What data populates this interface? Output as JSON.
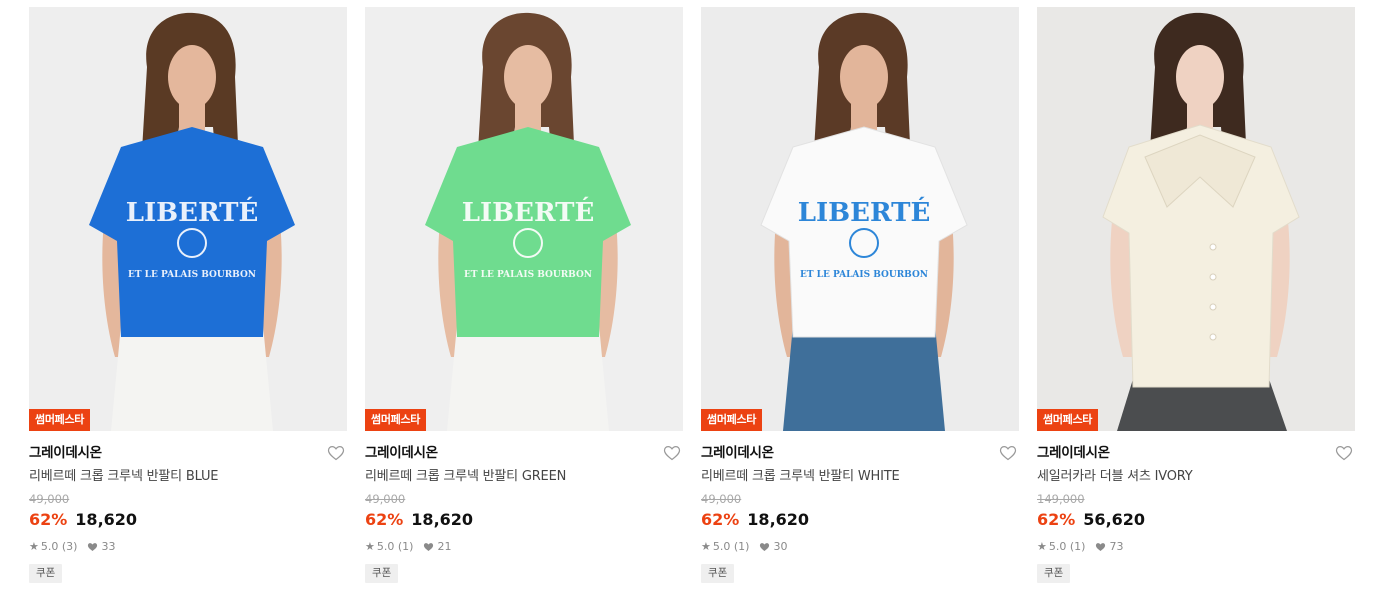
{
  "products": [
    {
      "badge": "썸머페스타",
      "brand": "그레이데시온",
      "name": "리베르떼 크롭 크루넥 반팔티 BLUE",
      "original_price": "49,000",
      "discount_rate": "62%",
      "price": "18,620",
      "rating": "5.0 (3)",
      "likes": "33",
      "coupon": "쿠폰",
      "print_text": "LIBERTÉ",
      "print_sub": "ET LE PALAIS BOURBON",
      "colors": {
        "bg": "#eeeeee",
        "top": "#1d6fd6",
        "print": "#e9f0fb",
        "bottom": "#f4f4f2",
        "hair": "#5a3a24",
        "skin": "#e4b79c"
      }
    },
    {
      "badge": "썸머페스타",
      "brand": "그레이데시온",
      "name": "리베르떼 크롭 크루넥 반팔티 GREEN",
      "original_price": "49,000",
      "discount_rate": "62%",
      "price": "18,620",
      "rating": "5.0 (1)",
      "likes": "21",
      "coupon": "쿠폰",
      "print_text": "LIBERTÉ",
      "print_sub": "ET LE PALAIS BOURBON",
      "colors": {
        "bg": "#efefef",
        "top": "#6fdc8f",
        "print": "#f3fbf5",
        "bottom": "#f4f4f2",
        "hair": "#6a4630",
        "skin": "#e6bca2"
      }
    },
    {
      "badge": "썸머페스타",
      "brand": "그레이데시온",
      "name": "리베르떼 크롭 크루넥 반팔티 WHITE",
      "original_price": "49,000",
      "discount_rate": "62%",
      "price": "18,620",
      "rating": "5.0 (1)",
      "likes": "30",
      "coupon": "쿠폰",
      "print_text": "LIBERTÉ",
      "print_sub": "ET LE PALAIS BOURBON",
      "colors": {
        "bg": "#ececec",
        "top": "#fafafa",
        "print": "#2d86d8",
        "bottom": "#3f6f9a",
        "hair": "#5b3a26",
        "skin": "#e2b59a"
      }
    },
    {
      "badge": "썸머페스타",
      "brand": "그레이데시온",
      "name": "세일러카라 더블 셔츠 IVORY",
      "original_price": "149,000",
      "discount_rate": "62%",
      "price": "56,620",
      "rating": "5.0 (1)",
      "likes": "73",
      "coupon": "쿠폰",
      "print_text": "",
      "print_sub": "",
      "colors": {
        "bg": "#e9e8e6",
        "top": "#f4efe0",
        "print": "#f4efe0",
        "bottom": "#4b4d4f",
        "hair": "#3e2a1f",
        "skin": "#efd2c2"
      }
    }
  ],
  "icons": {
    "wishlist": "heart-outline-icon",
    "like": "heart-filled-icon",
    "rating": "star-icon"
  }
}
